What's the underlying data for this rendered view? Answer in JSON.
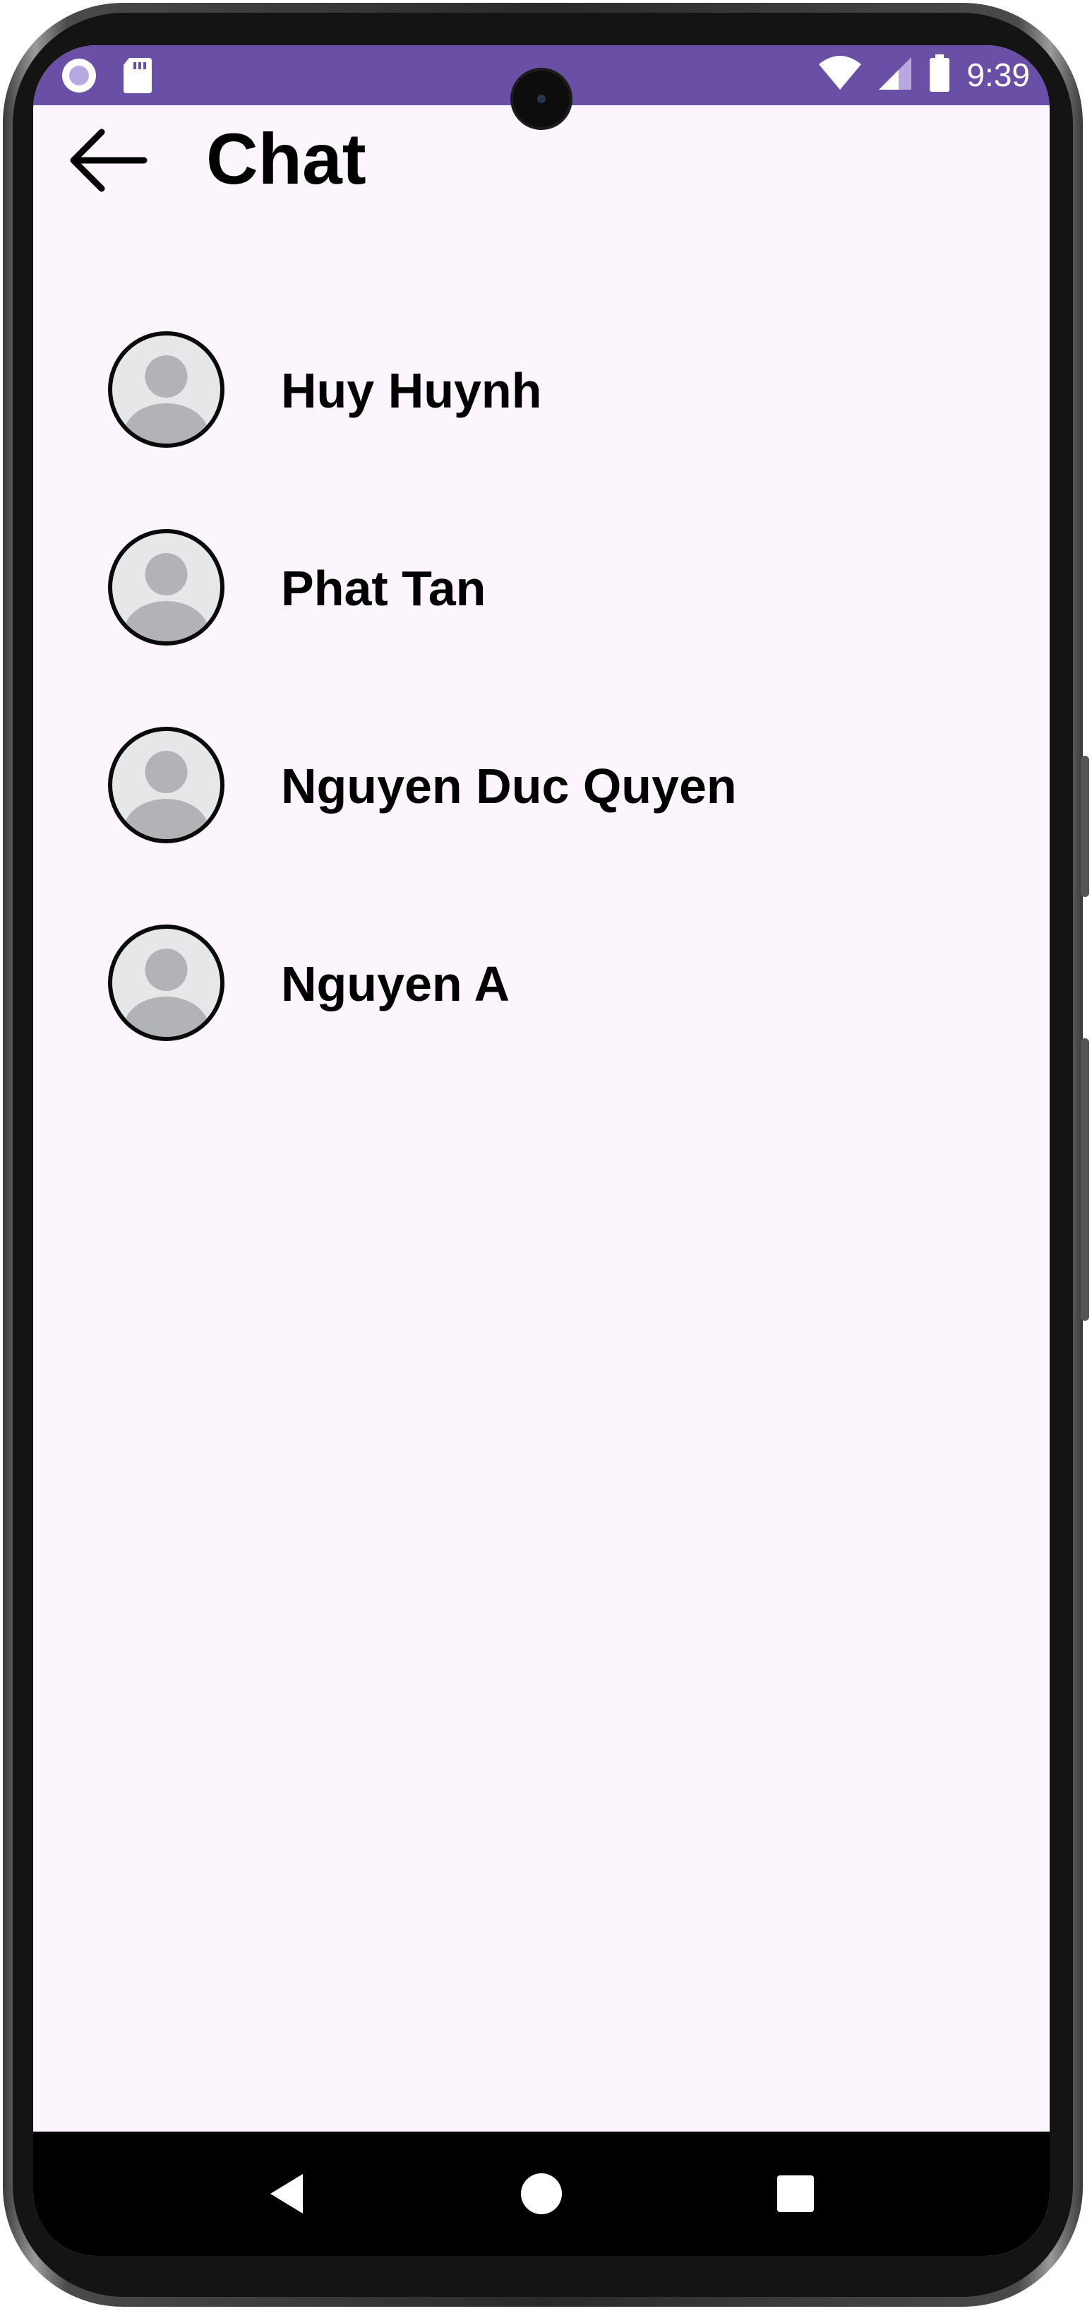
{
  "status_bar": {
    "time": "9:39",
    "background": "#6a4fa6",
    "icons_left": [
      "notification-circle-icon",
      "sd-card-icon"
    ],
    "icons_right": [
      "wifi-icon",
      "cellular-signal-icon",
      "battery-icon"
    ]
  },
  "app_bar": {
    "title": "Chat",
    "back_icon": "arrow-back-icon"
  },
  "contacts": [
    {
      "name": "Huy Huynh",
      "avatar_icon": "default-avatar-icon"
    },
    {
      "name": "Phat Tan",
      "avatar_icon": "default-avatar-icon"
    },
    {
      "name": "Nguyen Duc Quyen",
      "avatar_icon": "default-avatar-icon"
    },
    {
      "name": "Nguyen A",
      "avatar_icon": "default-avatar-icon"
    }
  ],
  "navigation_bar": {
    "buttons": [
      "back-triangle-icon",
      "home-circle-icon",
      "recents-square-icon"
    ]
  },
  "colors": {
    "screen_background": "#fcf5fd",
    "text": "#000000",
    "avatar_background": "#e6e7e9",
    "avatar_silhouette": "#b1b3b6"
  }
}
